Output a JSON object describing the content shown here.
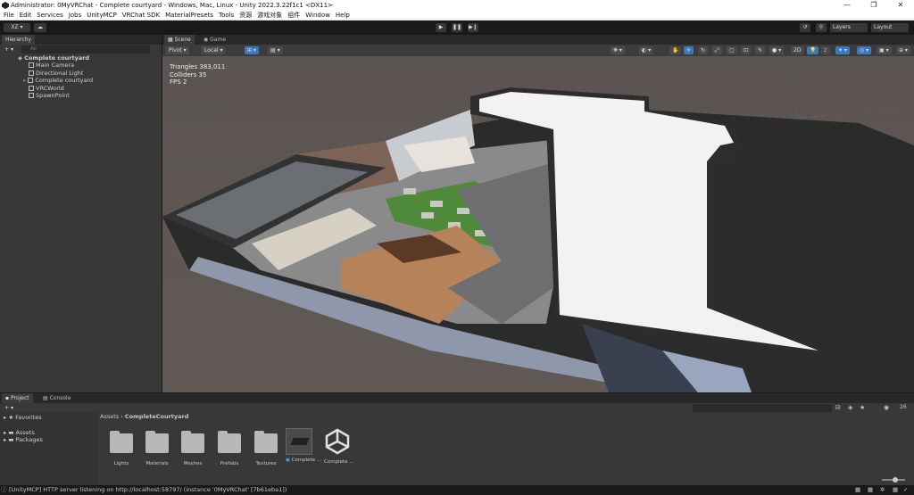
{
  "window": {
    "title": "Administrator: 0MyVRChat - Complete courtyard - Windows, Mac, Linux - Unity 2022.3.22f1c1 <DX11>",
    "minimize": "—",
    "maximize": "❐",
    "close": "✕"
  },
  "menu": [
    "File",
    "Edit",
    "Services",
    "Jobs",
    "UnityMCP",
    "VRChat SDK",
    "MaterialPresets",
    "Tools",
    "资源",
    "游戏对象",
    "组件",
    "Window",
    "Help"
  ],
  "toolbar": {
    "account": "XZ ▾",
    "cloud": "☁",
    "play": "▶",
    "pause": "❚❚",
    "step": "▶❙",
    "history": "↺",
    "search": "⚲",
    "layers": "Layers",
    "layout": "Layout"
  },
  "hierarchy": {
    "tab": "Hierarchy",
    "add": "+ ▾",
    "search_placeholder": "All",
    "scene": "Complete courtyard",
    "items": [
      "Main Camera",
      "Directional Light",
      "Complete courtyard",
      "VRCWorld",
      "SpawnPoint"
    ]
  },
  "scene_tabs": [
    "Scene",
    "Game"
  ],
  "scene_toolbar": {
    "pivot": "Pivot ▾",
    "local": "Local ▾",
    "mode_2d": "2D"
  },
  "stats": {
    "triangles": "Triangles 383,011",
    "colliders": "Colliders 35",
    "fps": "FPS 2"
  },
  "project": {
    "tabs": [
      "Project",
      "Console"
    ],
    "add": "+ ▾",
    "favorites": "Favorites",
    "assets": "Assets",
    "packages": "Packages",
    "breadcrumb_root": "Assets",
    "breadcrumb_sep": "›",
    "breadcrumb_current": "CompleteCourtyard",
    "items": [
      "Lights",
      "Materials",
      "Meshes",
      "Prefabs",
      "Textures",
      "Complete ...",
      "Complete ..."
    ],
    "count": "26"
  },
  "status": {
    "message": "[UnityMCP] HTTP server listening on http://localhost:58797/ (instance '0MyVRChat' [7b61eba1])"
  },
  "colors": {
    "editor_bg": "#383838",
    "dark_bg": "#191919",
    "selected_tab": "#3c3c3c",
    "accent_blue": "#3a79bb"
  }
}
